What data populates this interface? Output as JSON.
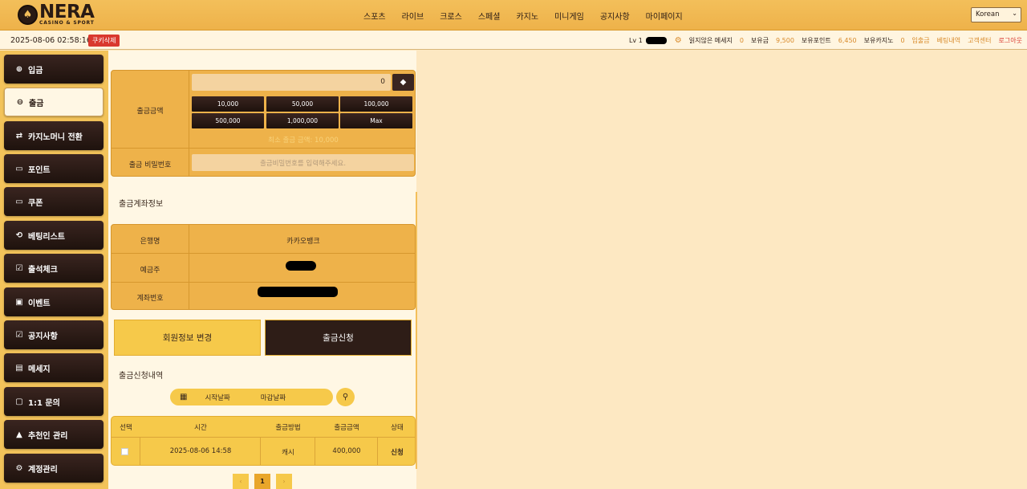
{
  "header": {
    "logo_symbol": "♠",
    "logo_name": "NERA",
    "logo_sub": "CASINO & SPORT",
    "nav": [
      "스포츠",
      "라이브",
      "크로스",
      "스페셜",
      "카지노",
      "미니게임",
      "공지사항",
      "마이페이지"
    ],
    "language": "Korean"
  },
  "infobar": {
    "datetime": "2025-08-06 02:58:16",
    "cookie_btn": "쿠키삭제",
    "level": "Lv 1",
    "unread_label": "읽지않은 메세지",
    "unread_count": "0",
    "balance_label": "보유금",
    "balance": "9,500",
    "points_label": "보유포인트",
    "points": "6,450",
    "casino_label": "보유카지노",
    "casino": "0",
    "deposit_link": "입출금",
    "betting_link": "베팅내역",
    "support_link": "고객센터",
    "logout_link": "로그아웃"
  },
  "sidebar": {
    "items": [
      {
        "label": "입금",
        "icon": "⊕"
      },
      {
        "label": "출금",
        "icon": "⊖"
      },
      {
        "label": "카지노머니 전환",
        "icon": "⇄"
      },
      {
        "label": "포인트",
        "icon": "▭"
      },
      {
        "label": "쿠폰",
        "icon": "▭"
      },
      {
        "label": "베팅리스트",
        "icon": "⟲"
      },
      {
        "label": "출석체크",
        "icon": "☑"
      },
      {
        "label": "이벤트",
        "icon": "▣"
      },
      {
        "label": "공지사항",
        "icon": "☑"
      },
      {
        "label": "메세지",
        "icon": "▤"
      },
      {
        "label": "1:1 문의",
        "icon": "▢"
      },
      {
        "label": "추천인 관리",
        "icon": "▲"
      },
      {
        "label": "계정관리",
        "icon": "⚙"
      }
    ]
  },
  "withdraw": {
    "amount_label": "출금금액",
    "amount_value": "0",
    "quick_amounts": [
      "10,000",
      "50,000",
      "100,000",
      "500,000",
      "1,000,000",
      "Max"
    ],
    "min_note": "최소 출금 금액: 10,000",
    "password_label": "출금 비밀번호",
    "password_placeholder": "출금비밀번호를 입력해주세요."
  },
  "account": {
    "title": "출금계좌정보",
    "bank_label": "은행명",
    "bank_value": "카카오뱅크",
    "holder_label": "예금주",
    "number_label": "계좌번호"
  },
  "actions": {
    "edit_profile": "회원정보 변경",
    "request_withdraw": "출금신청"
  },
  "history": {
    "title": "출금신청내역",
    "start_date": "시작날짜",
    "end_date": "마감날짜",
    "columns": [
      "선택",
      "시간",
      "출금방법",
      "출금금액",
      "상태"
    ],
    "rows": [
      {
        "time": "2025-08-06 14:58",
        "method": "캐시",
        "amount": "400,000",
        "status": "신청"
      }
    ],
    "pagination": {
      "prev": "‹",
      "current": "1",
      "next": "›"
    }
  },
  "colors": {
    "accent": "#eeb24a",
    "dark": "#2a1b14",
    "red": "#d9382e"
  }
}
